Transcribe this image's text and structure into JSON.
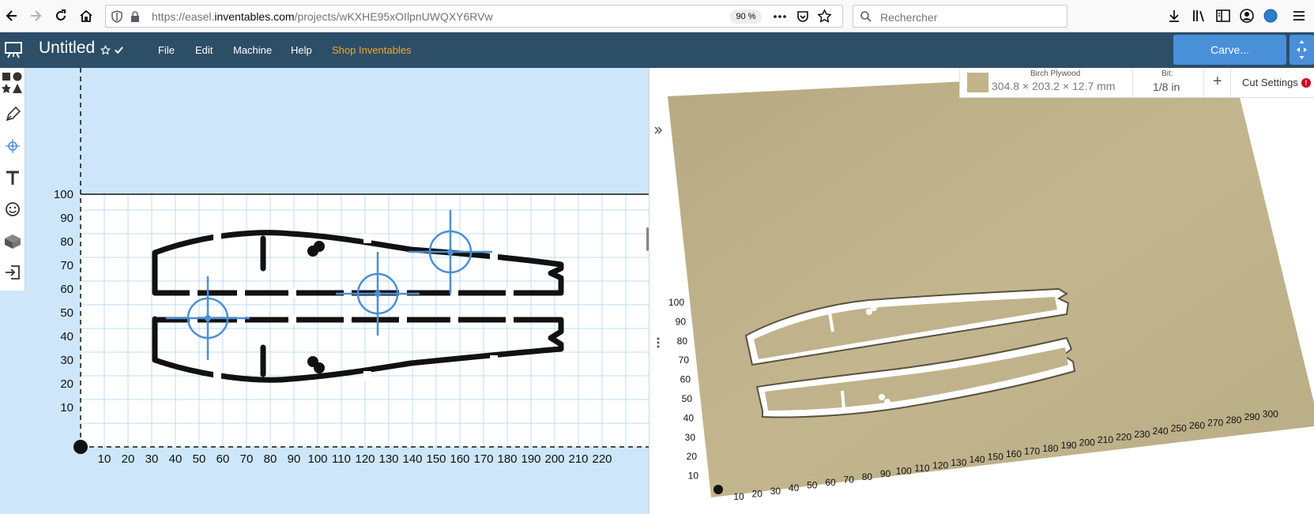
{
  "browser": {
    "url_prefix": "https://easel.",
    "url_host": "inventables.com",
    "url_path": "/projects/wKXHE95xOIlpnUWQXY6RVw",
    "zoom": "90 %",
    "search_placeholder": "Rechercher"
  },
  "app": {
    "title": "Untitled",
    "menu": [
      "File",
      "Edit",
      "Machine",
      "Help",
      "Shop Inventables"
    ],
    "carve_label": "Carve..."
  },
  "toolbar": {
    "tools": [
      "shapes-icon",
      "pen-icon",
      "target-icon",
      "text-icon",
      "icons-smiley-icon",
      "apps-box-icon",
      "import-icon"
    ]
  },
  "design_canvas": {
    "y_ticks": [
      "100",
      "90",
      "80",
      "70",
      "60",
      "50",
      "40",
      "30",
      "20",
      "10"
    ],
    "x_ticks": [
      "10",
      "20",
      "30",
      "40",
      "50",
      "60",
      "70",
      "80",
      "90",
      "100",
      "110",
      "120",
      "130",
      "140",
      "150",
      "160",
      "170",
      "180",
      "190",
      "200",
      "210",
      "220"
    ]
  },
  "preview": {
    "material_name": "Birch Plywood",
    "material_dims": "304.8 × 203.2 × 12.7 mm",
    "bit_label": "Bit:",
    "bit_value": "1/8 in",
    "plus": "+",
    "cut_settings": "Cut Settings",
    "warning": "!",
    "x_ticks": [
      "10",
      "20",
      "30",
      "40",
      "50",
      "60",
      "70",
      "80",
      "90",
      "100",
      "110",
      "120",
      "130",
      "140",
      "150",
      "160",
      "170",
      "180",
      "190",
      "200",
      "210",
      "220",
      "230",
      "240",
      "250",
      "260",
      "270",
      "280",
      "290",
      "300"
    ],
    "y_ticks": [
      "100",
      "90",
      "80",
      "70",
      "60",
      "50",
      "40",
      "30",
      "20",
      "10"
    ]
  },
  "colors": {
    "header": "#2d4e67",
    "accent": "#4a90d9",
    "shop_link": "#f5a623",
    "canvas_bg": "#cde6fa",
    "wood": "#c2b48a"
  }
}
